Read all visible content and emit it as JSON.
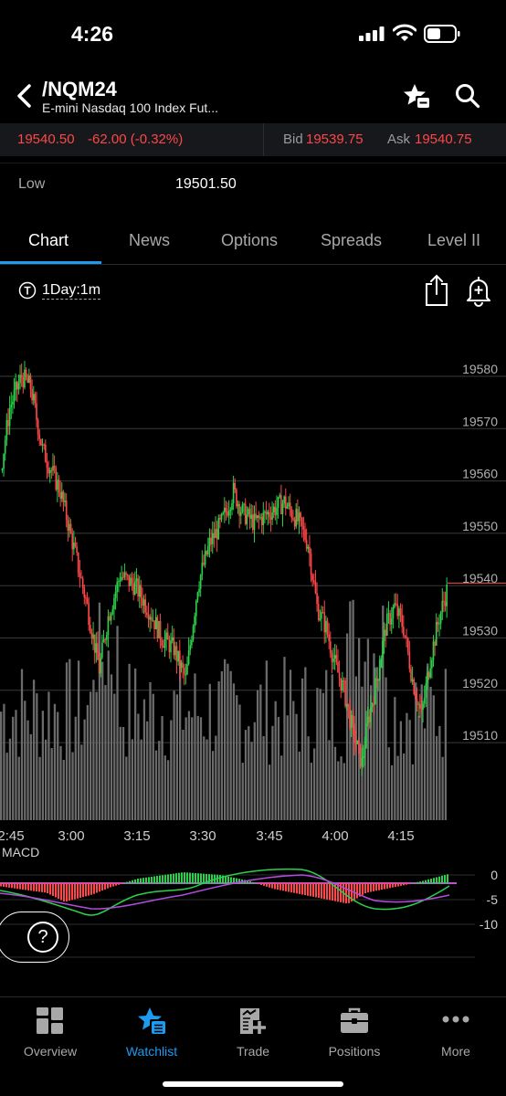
{
  "status": {
    "time": "4:26"
  },
  "header": {
    "symbol": "/NQM24",
    "description": "E-mini Nasdaq 100 Index Fut..."
  },
  "quote": {
    "last": "19540.50",
    "change": "-62.00 (-0.32%)",
    "bid_label": "Bid",
    "bid": "19539.75",
    "ask_label": "Ask",
    "ask": "19540.75",
    "colors": {
      "down": "#ff4747",
      "up": "#2bd14a"
    }
  },
  "stats": {
    "low_label": "Low",
    "low_value": "19501.50"
  },
  "tabs": [
    "Chart",
    "News",
    "Options",
    "Spreads",
    "Level II"
  ],
  "active_tab": "Chart",
  "chart_toolbar": {
    "timeframe": "1Day:1m"
  },
  "chart_data": {
    "type": "candlestick",
    "y_ticks": [
      "19580",
      "19570",
      "19560",
      "19550",
      "19540",
      "19530",
      "19520",
      "19510"
    ],
    "x_ticks": [
      "2:45",
      "3:00",
      "3:15",
      "3:30",
      "3:45",
      "4:00",
      "4:15"
    ],
    "ylim": [
      19501.5,
      19586
    ],
    "last_price": 19540.5,
    "macd": {
      "label": "MACD",
      "y_ticks": [
        "0",
        "-5",
        "-10"
      ]
    }
  },
  "help": {
    "label": "?"
  },
  "bottom_nav": [
    {
      "label": "Overview",
      "icon": "overview-icon"
    },
    {
      "label": "Watchlist",
      "icon": "watchlist-icon"
    },
    {
      "label": "Trade",
      "icon": "trade-icon"
    },
    {
      "label": "Positions",
      "icon": "positions-icon"
    },
    {
      "label": "More",
      "icon": "more-icon"
    }
  ],
  "active_nav": "Watchlist"
}
